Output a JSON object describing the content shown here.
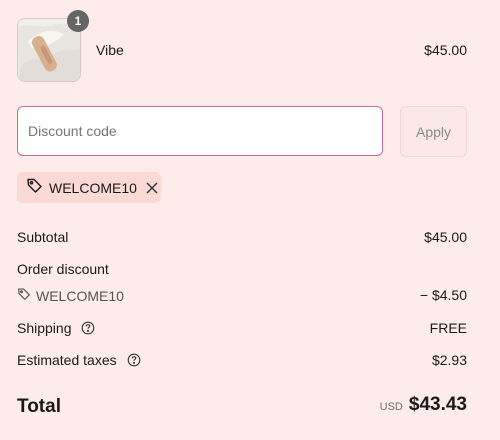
{
  "product": {
    "name": "Vibe",
    "price": "$45.00",
    "quantity": "1",
    "image": "product-thumbnail"
  },
  "discount": {
    "placeholder": "Discount code",
    "value": "",
    "apply_label": "Apply"
  },
  "applied_code": {
    "code": "WELCOME10",
    "icon": "tag-icon",
    "remove_icon": "close-icon"
  },
  "summary": {
    "subtotal_label": "Subtotal",
    "subtotal_value": "$45.00",
    "order_discount_label": "Order discount",
    "discount_code": "WELCOME10",
    "discount_value": "− $4.50",
    "shipping_label": "Shipping",
    "shipping_value": "FREE",
    "taxes_label": "Estimated taxes",
    "taxes_value": "$2.93",
    "total_label": "Total",
    "currency": "USD",
    "total_value": "$43.43"
  },
  "colors": {
    "background": "#fdecea",
    "input_border": "#c86aa0",
    "chip_background": "#fbd9d4",
    "apply_button": "#fbe9e8"
  }
}
